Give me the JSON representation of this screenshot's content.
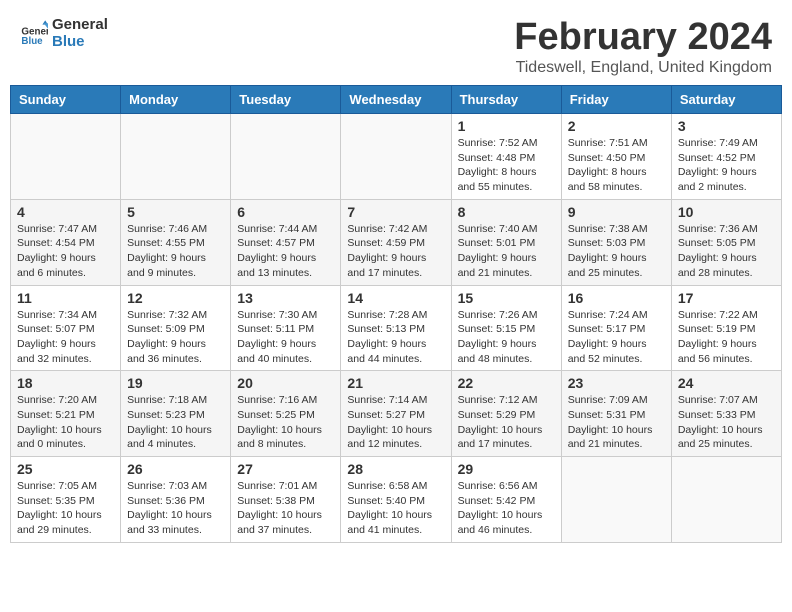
{
  "header": {
    "logo_line1": "General",
    "logo_line2": "Blue",
    "month_title": "February 2024",
    "location": "Tideswell, England, United Kingdom"
  },
  "weekdays": [
    "Sunday",
    "Monday",
    "Tuesday",
    "Wednesday",
    "Thursday",
    "Friday",
    "Saturday"
  ],
  "weeks": [
    [
      {
        "day": "",
        "info": ""
      },
      {
        "day": "",
        "info": ""
      },
      {
        "day": "",
        "info": ""
      },
      {
        "day": "",
        "info": ""
      },
      {
        "day": "1",
        "info": "Sunrise: 7:52 AM\nSunset: 4:48 PM\nDaylight: 8 hours\nand 55 minutes."
      },
      {
        "day": "2",
        "info": "Sunrise: 7:51 AM\nSunset: 4:50 PM\nDaylight: 8 hours\nand 58 minutes."
      },
      {
        "day": "3",
        "info": "Sunrise: 7:49 AM\nSunset: 4:52 PM\nDaylight: 9 hours\nand 2 minutes."
      }
    ],
    [
      {
        "day": "4",
        "info": "Sunrise: 7:47 AM\nSunset: 4:54 PM\nDaylight: 9 hours\nand 6 minutes."
      },
      {
        "day": "5",
        "info": "Sunrise: 7:46 AM\nSunset: 4:55 PM\nDaylight: 9 hours\nand 9 minutes."
      },
      {
        "day": "6",
        "info": "Sunrise: 7:44 AM\nSunset: 4:57 PM\nDaylight: 9 hours\nand 13 minutes."
      },
      {
        "day": "7",
        "info": "Sunrise: 7:42 AM\nSunset: 4:59 PM\nDaylight: 9 hours\nand 17 minutes."
      },
      {
        "day": "8",
        "info": "Sunrise: 7:40 AM\nSunset: 5:01 PM\nDaylight: 9 hours\nand 21 minutes."
      },
      {
        "day": "9",
        "info": "Sunrise: 7:38 AM\nSunset: 5:03 PM\nDaylight: 9 hours\nand 25 minutes."
      },
      {
        "day": "10",
        "info": "Sunrise: 7:36 AM\nSunset: 5:05 PM\nDaylight: 9 hours\nand 28 minutes."
      }
    ],
    [
      {
        "day": "11",
        "info": "Sunrise: 7:34 AM\nSunset: 5:07 PM\nDaylight: 9 hours\nand 32 minutes."
      },
      {
        "day": "12",
        "info": "Sunrise: 7:32 AM\nSunset: 5:09 PM\nDaylight: 9 hours\nand 36 minutes."
      },
      {
        "day": "13",
        "info": "Sunrise: 7:30 AM\nSunset: 5:11 PM\nDaylight: 9 hours\nand 40 minutes."
      },
      {
        "day": "14",
        "info": "Sunrise: 7:28 AM\nSunset: 5:13 PM\nDaylight: 9 hours\nand 44 minutes."
      },
      {
        "day": "15",
        "info": "Sunrise: 7:26 AM\nSunset: 5:15 PM\nDaylight: 9 hours\nand 48 minutes."
      },
      {
        "day": "16",
        "info": "Sunrise: 7:24 AM\nSunset: 5:17 PM\nDaylight: 9 hours\nand 52 minutes."
      },
      {
        "day": "17",
        "info": "Sunrise: 7:22 AM\nSunset: 5:19 PM\nDaylight: 9 hours\nand 56 minutes."
      }
    ],
    [
      {
        "day": "18",
        "info": "Sunrise: 7:20 AM\nSunset: 5:21 PM\nDaylight: 10 hours\nand 0 minutes."
      },
      {
        "day": "19",
        "info": "Sunrise: 7:18 AM\nSunset: 5:23 PM\nDaylight: 10 hours\nand 4 minutes."
      },
      {
        "day": "20",
        "info": "Sunrise: 7:16 AM\nSunset: 5:25 PM\nDaylight: 10 hours\nand 8 minutes."
      },
      {
        "day": "21",
        "info": "Sunrise: 7:14 AM\nSunset: 5:27 PM\nDaylight: 10 hours\nand 12 minutes."
      },
      {
        "day": "22",
        "info": "Sunrise: 7:12 AM\nSunset: 5:29 PM\nDaylight: 10 hours\nand 17 minutes."
      },
      {
        "day": "23",
        "info": "Sunrise: 7:09 AM\nSunset: 5:31 PM\nDaylight: 10 hours\nand 21 minutes."
      },
      {
        "day": "24",
        "info": "Sunrise: 7:07 AM\nSunset: 5:33 PM\nDaylight: 10 hours\nand 25 minutes."
      }
    ],
    [
      {
        "day": "25",
        "info": "Sunrise: 7:05 AM\nSunset: 5:35 PM\nDaylight: 10 hours\nand 29 minutes."
      },
      {
        "day": "26",
        "info": "Sunrise: 7:03 AM\nSunset: 5:36 PM\nDaylight: 10 hours\nand 33 minutes."
      },
      {
        "day": "27",
        "info": "Sunrise: 7:01 AM\nSunset: 5:38 PM\nDaylight: 10 hours\nand 37 minutes."
      },
      {
        "day": "28",
        "info": "Sunrise: 6:58 AM\nSunset: 5:40 PM\nDaylight: 10 hours\nand 41 minutes."
      },
      {
        "day": "29",
        "info": "Sunrise: 6:56 AM\nSunset: 5:42 PM\nDaylight: 10 hours\nand 46 minutes."
      },
      {
        "day": "",
        "info": ""
      },
      {
        "day": "",
        "info": ""
      }
    ]
  ]
}
